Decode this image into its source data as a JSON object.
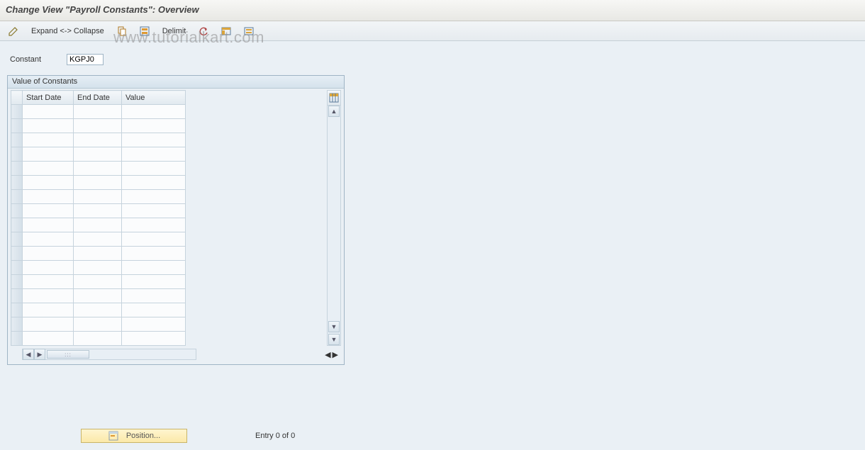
{
  "header": {
    "title": "Change View \"Payroll Constants\": Overview"
  },
  "watermark": "www.tutorialkart.com",
  "toolbar": {
    "expand_collapse_label": "Expand <-> Collapse",
    "delimit_label": "Delimit"
  },
  "field": {
    "label": "Constant",
    "value": "KGPJ0"
  },
  "panel": {
    "title": "Value of Constants",
    "columns": {
      "start_date": "Start Date",
      "end_date": "End Date",
      "value": "Value"
    },
    "row_count": 17
  },
  "footer": {
    "position_label": "Position...",
    "entry_text": "Entry 0 of 0"
  }
}
